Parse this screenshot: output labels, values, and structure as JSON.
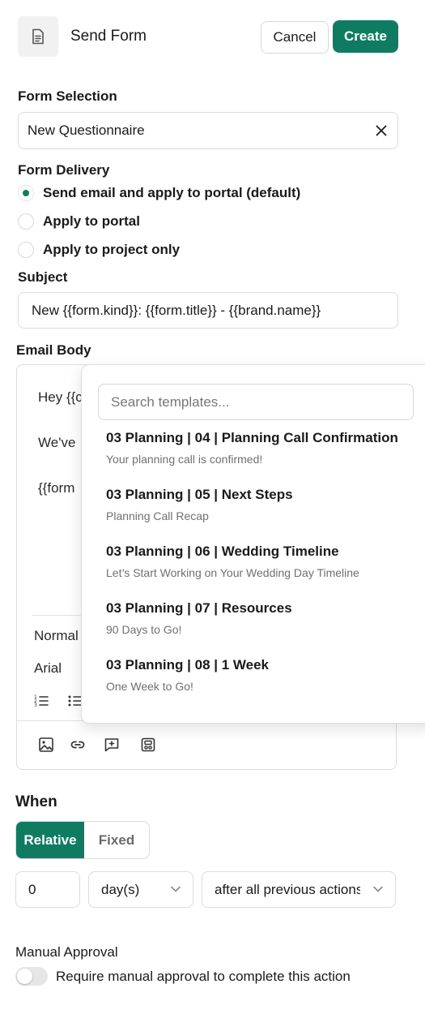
{
  "header": {
    "title": "Send Form",
    "cancel_label": "Cancel",
    "create_label": "Create"
  },
  "form_selection": {
    "label": "Form Selection",
    "value": "New Questionnaire"
  },
  "form_delivery": {
    "label": "Form Delivery",
    "options": [
      {
        "label": "Send email and apply to portal (default)",
        "selected": true
      },
      {
        "label": "Apply to portal",
        "selected": false
      },
      {
        "label": "Apply to project only",
        "selected": false
      }
    ]
  },
  "subject": {
    "label": "Subject",
    "value": "New {{form.kind}}: {{form.title}} - {{brand.name}}"
  },
  "email_body": {
    "label": "Email Body",
    "lines": [
      "Hey {{c",
      "We've",
      "{{form"
    ],
    "style_select": "Normal",
    "font_select": "Arial"
  },
  "template_dropdown": {
    "search_placeholder": "Search templates...",
    "items": [
      {
        "title": "03 Planning | 04 | Planning Call Confirmation",
        "subtitle": "Your planning call is confirmed!"
      },
      {
        "title": "03 Planning | 05 | Next Steps",
        "subtitle": "Planning Call Recap"
      },
      {
        "title": "03 Planning | 06 | Wedding Timeline",
        "subtitle": "Let’s Start Working on Your Wedding Day Timeline"
      },
      {
        "title": "03 Planning | 07 | Resources",
        "subtitle": "90 Days to Go!"
      },
      {
        "title": "03 Planning | 08 | 1 Week",
        "subtitle": "One Week to Go!"
      }
    ]
  },
  "when": {
    "label": "When",
    "relative_label": "Relative",
    "fixed_label": "Fixed",
    "active": "Relative",
    "amount": "0",
    "unit": "day(s)",
    "anchor": "after all previous actions"
  },
  "manual_approval": {
    "label": "Manual Approval",
    "toggle_label": "Require manual approval to complete this action",
    "enabled": false
  },
  "colors": {
    "accent": "#0f7c62"
  }
}
